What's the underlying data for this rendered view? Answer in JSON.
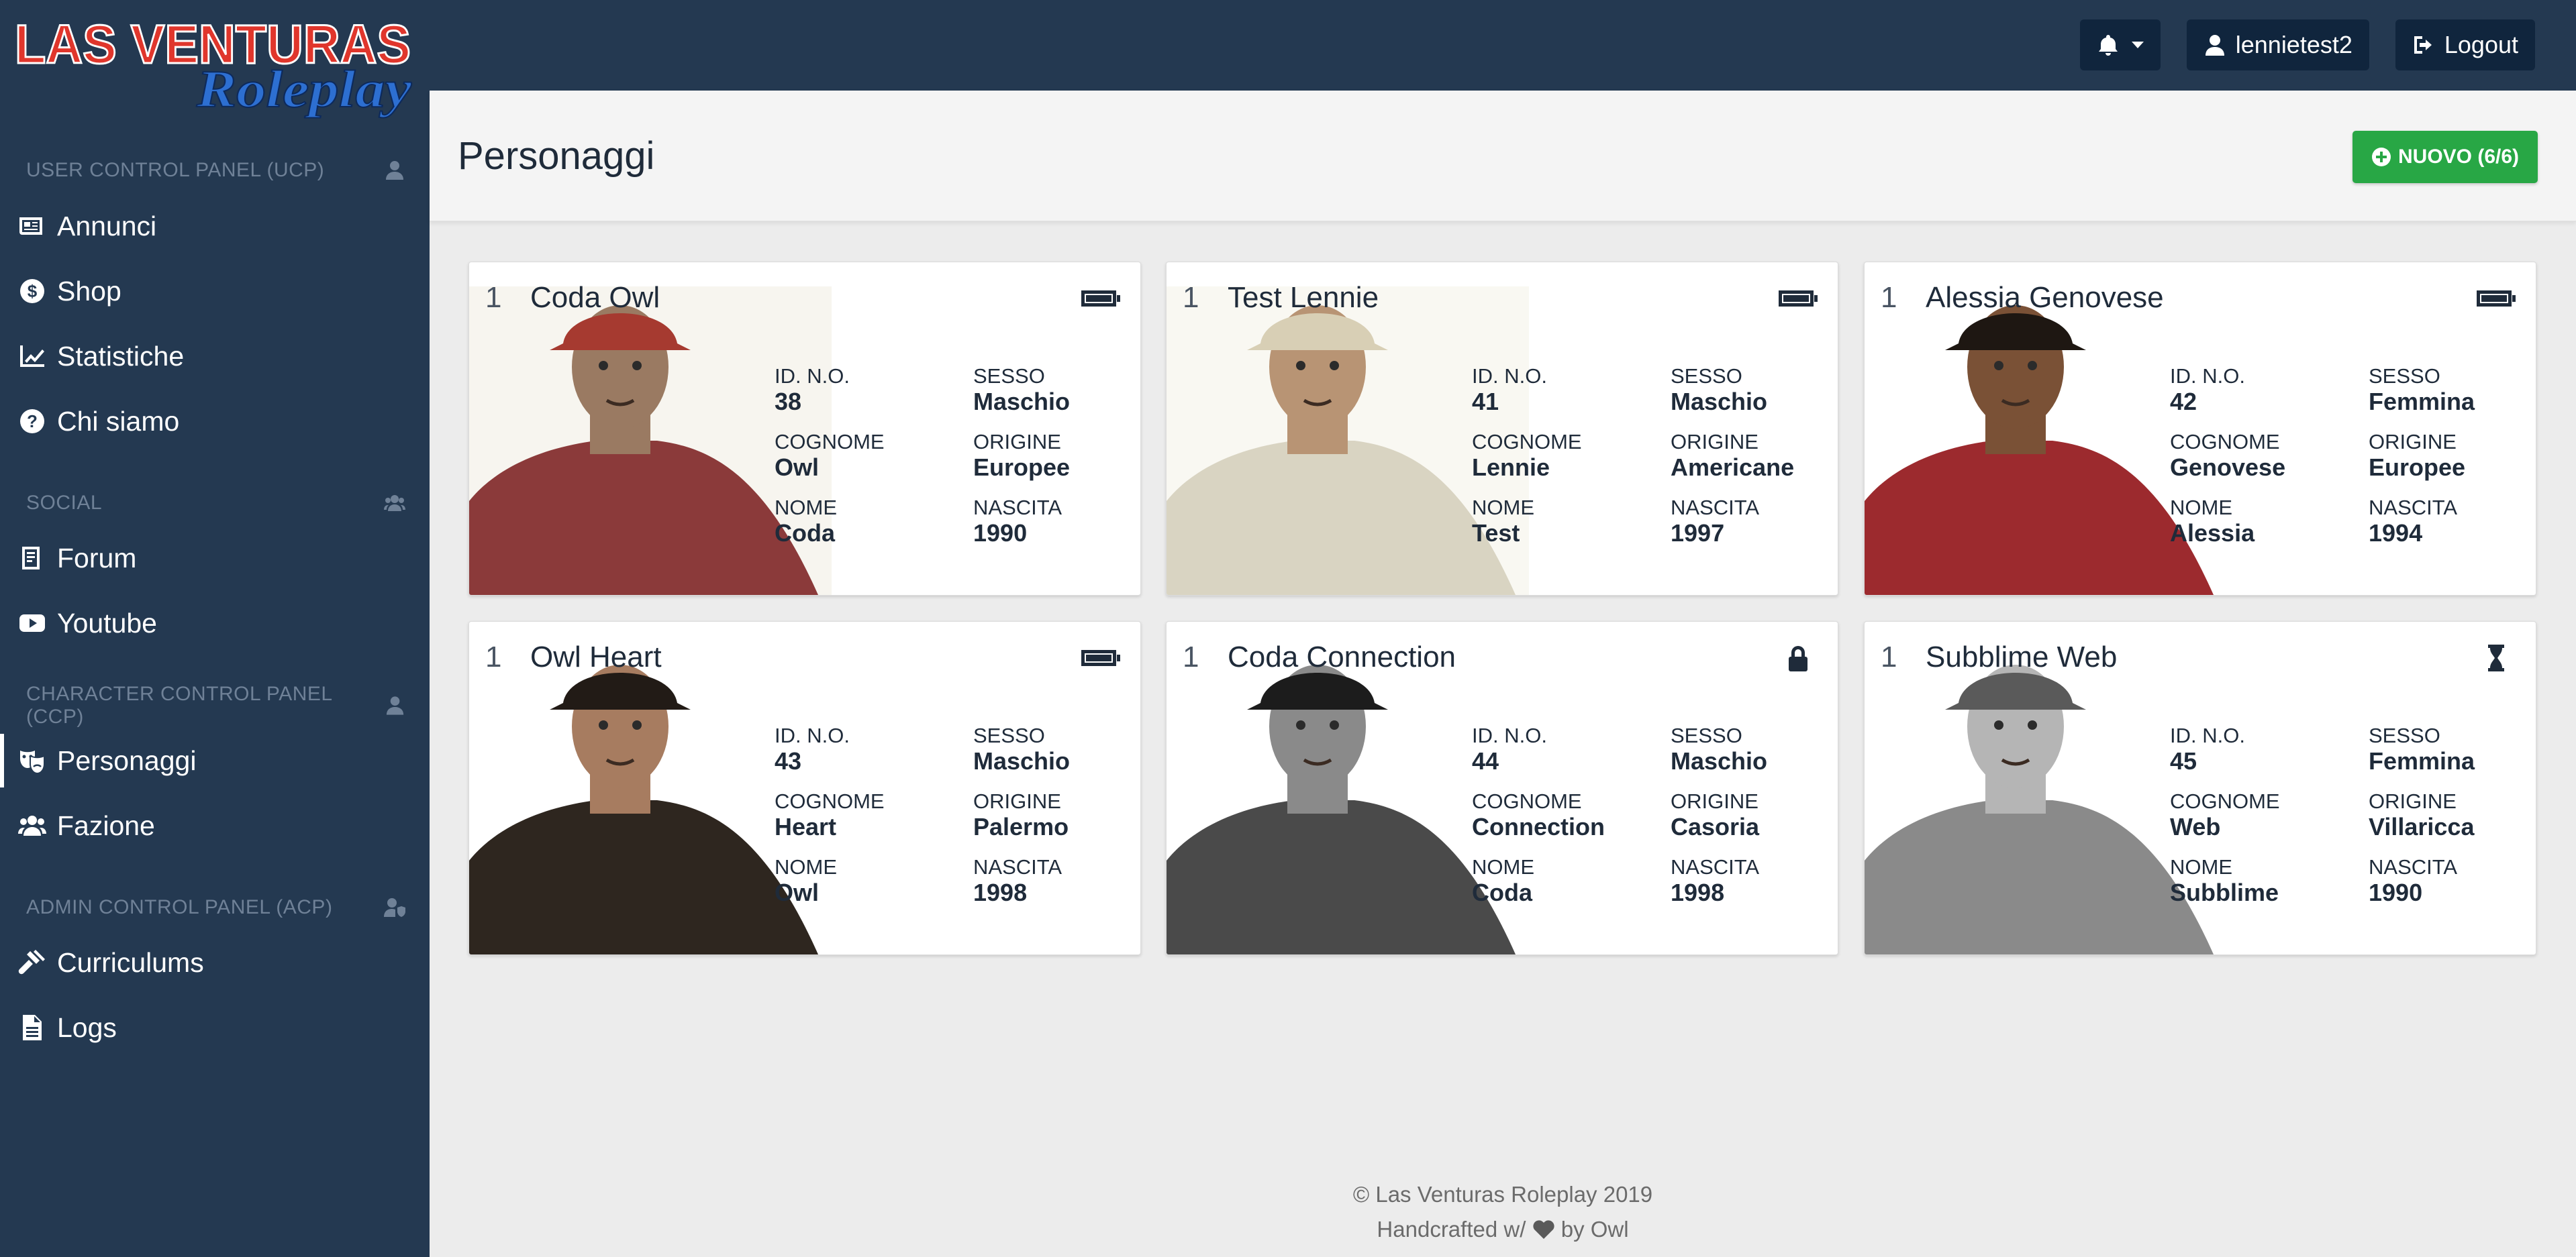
{
  "app": {
    "logo_line1": "LAS VENTURAS",
    "logo_line2": "Roleplay"
  },
  "topbar": {
    "notifications_icon": "bell-icon",
    "user_label": "lennietest2",
    "logout_label": "Logout"
  },
  "sidebar": {
    "sections": [
      {
        "title": "USER CONTROL PANEL (UCP)",
        "icon": "user-icon",
        "items": [
          {
            "label": "Annunci",
            "icon": "newspaper-icon"
          },
          {
            "label": "Shop",
            "icon": "coin-icon"
          },
          {
            "label": "Statistiche",
            "icon": "line-chart-icon"
          },
          {
            "label": "Chi siamo",
            "icon": "question-circle-icon"
          }
        ]
      },
      {
        "title": "SOCIAL",
        "icon": "users-icon",
        "items": [
          {
            "label": "Forum",
            "icon": "forum-icon"
          },
          {
            "label": "Youtube",
            "icon": "youtube-icon"
          }
        ]
      },
      {
        "title": "CHARACTER CONTROL PANEL (CCP)",
        "icon": "user-icon",
        "items": [
          {
            "label": "Personaggi",
            "icon": "masks-icon",
            "active": true
          },
          {
            "label": "Fazione",
            "icon": "users-icon"
          }
        ]
      },
      {
        "title": "ADMIN CONTROL PANEL (ACP)",
        "icon": "user-shield-icon",
        "items": [
          {
            "label": "Curriculums",
            "icon": "gavel-icon"
          },
          {
            "label": "Logs",
            "icon": "file-icon"
          }
        ]
      }
    ]
  },
  "page": {
    "title": "Personaggi",
    "new_button_label": "NUOVO (6/6)"
  },
  "labels": {
    "id": "ID. N.O.",
    "sesso": "SESSO",
    "cognome": "COGNOME",
    "origine": "ORIGINE",
    "nome": "NOME",
    "nascita": "NASCITA"
  },
  "characters": [
    {
      "num": "1",
      "name": "Coda Owl",
      "id": "38",
      "sesso": "Maschio",
      "cognome": "Owl",
      "origine": "Europee",
      "nome": "Coda",
      "nascita": "1990",
      "status_icon": "battery-icon",
      "colors": {
        "skin": "#9a7a62",
        "shirt": "#8b3a3a",
        "hat": "#a63a30",
        "bg": "#f7f5ef"
      }
    },
    {
      "num": "1",
      "name": "Test Lennie",
      "id": "41",
      "sesso": "Maschio",
      "cognome": "Lennie",
      "origine": "Americane",
      "nome": "Test",
      "nascita": "1997",
      "status_icon": "battery-icon",
      "colors": {
        "skin": "#b89474",
        "shirt": "#d9d4c2",
        "hat": "#d8cfb5",
        "bg": "#f9f8f2"
      }
    },
    {
      "num": "1",
      "name": "Alessia Genovese",
      "id": "42",
      "sesso": "Femmina",
      "cognome": "Genovese",
      "origine": "Europee",
      "nome": "Alessia",
      "nascita": "1994",
      "status_icon": "battery-icon",
      "colors": {
        "skin": "#7a5136",
        "shirt": "#9c2a2e",
        "hat": "#1e1712",
        "bg": "#ffffff"
      }
    },
    {
      "num": "1",
      "name": "Owl Heart",
      "id": "43",
      "sesso": "Maschio",
      "cognome": "Heart",
      "origine": "Palermo",
      "nome": "Owl",
      "nascita": "1998",
      "status_icon": "battery-icon",
      "colors": {
        "skin": "#a77c60",
        "shirt": "#2e261f",
        "hat": "#221b16",
        "bg": "#ffffff"
      }
    },
    {
      "num": "1",
      "name": "Coda Connection",
      "id": "44",
      "sesso": "Maschio",
      "cognome": "Connection",
      "origine": "Casoria",
      "nome": "Coda",
      "nascita": "1998",
      "status_icon": "lock-icon",
      "colors": {
        "skin": "#8a8a8a",
        "shirt": "#4a4a4a",
        "hat": "#1c1c1c",
        "bg": "#ffffff"
      }
    },
    {
      "num": "1",
      "name": "Subblime Web",
      "id": "45",
      "sesso": "Femmina",
      "cognome": "Web",
      "origine": "Villaricca",
      "nome": "Subblime",
      "nascita": "1990",
      "status_icon": "hourglass-icon",
      "colors": {
        "skin": "#b5b5b5",
        "shirt": "#8a8a8a",
        "hat": "#5a5a5a",
        "bg": "#ffffff"
      }
    }
  ],
  "footer": {
    "copyright": "© Las Venturas Roleplay 2019",
    "credit_prefix": "Handcrafted w/",
    "credit_suffix": "by Owl"
  }
}
